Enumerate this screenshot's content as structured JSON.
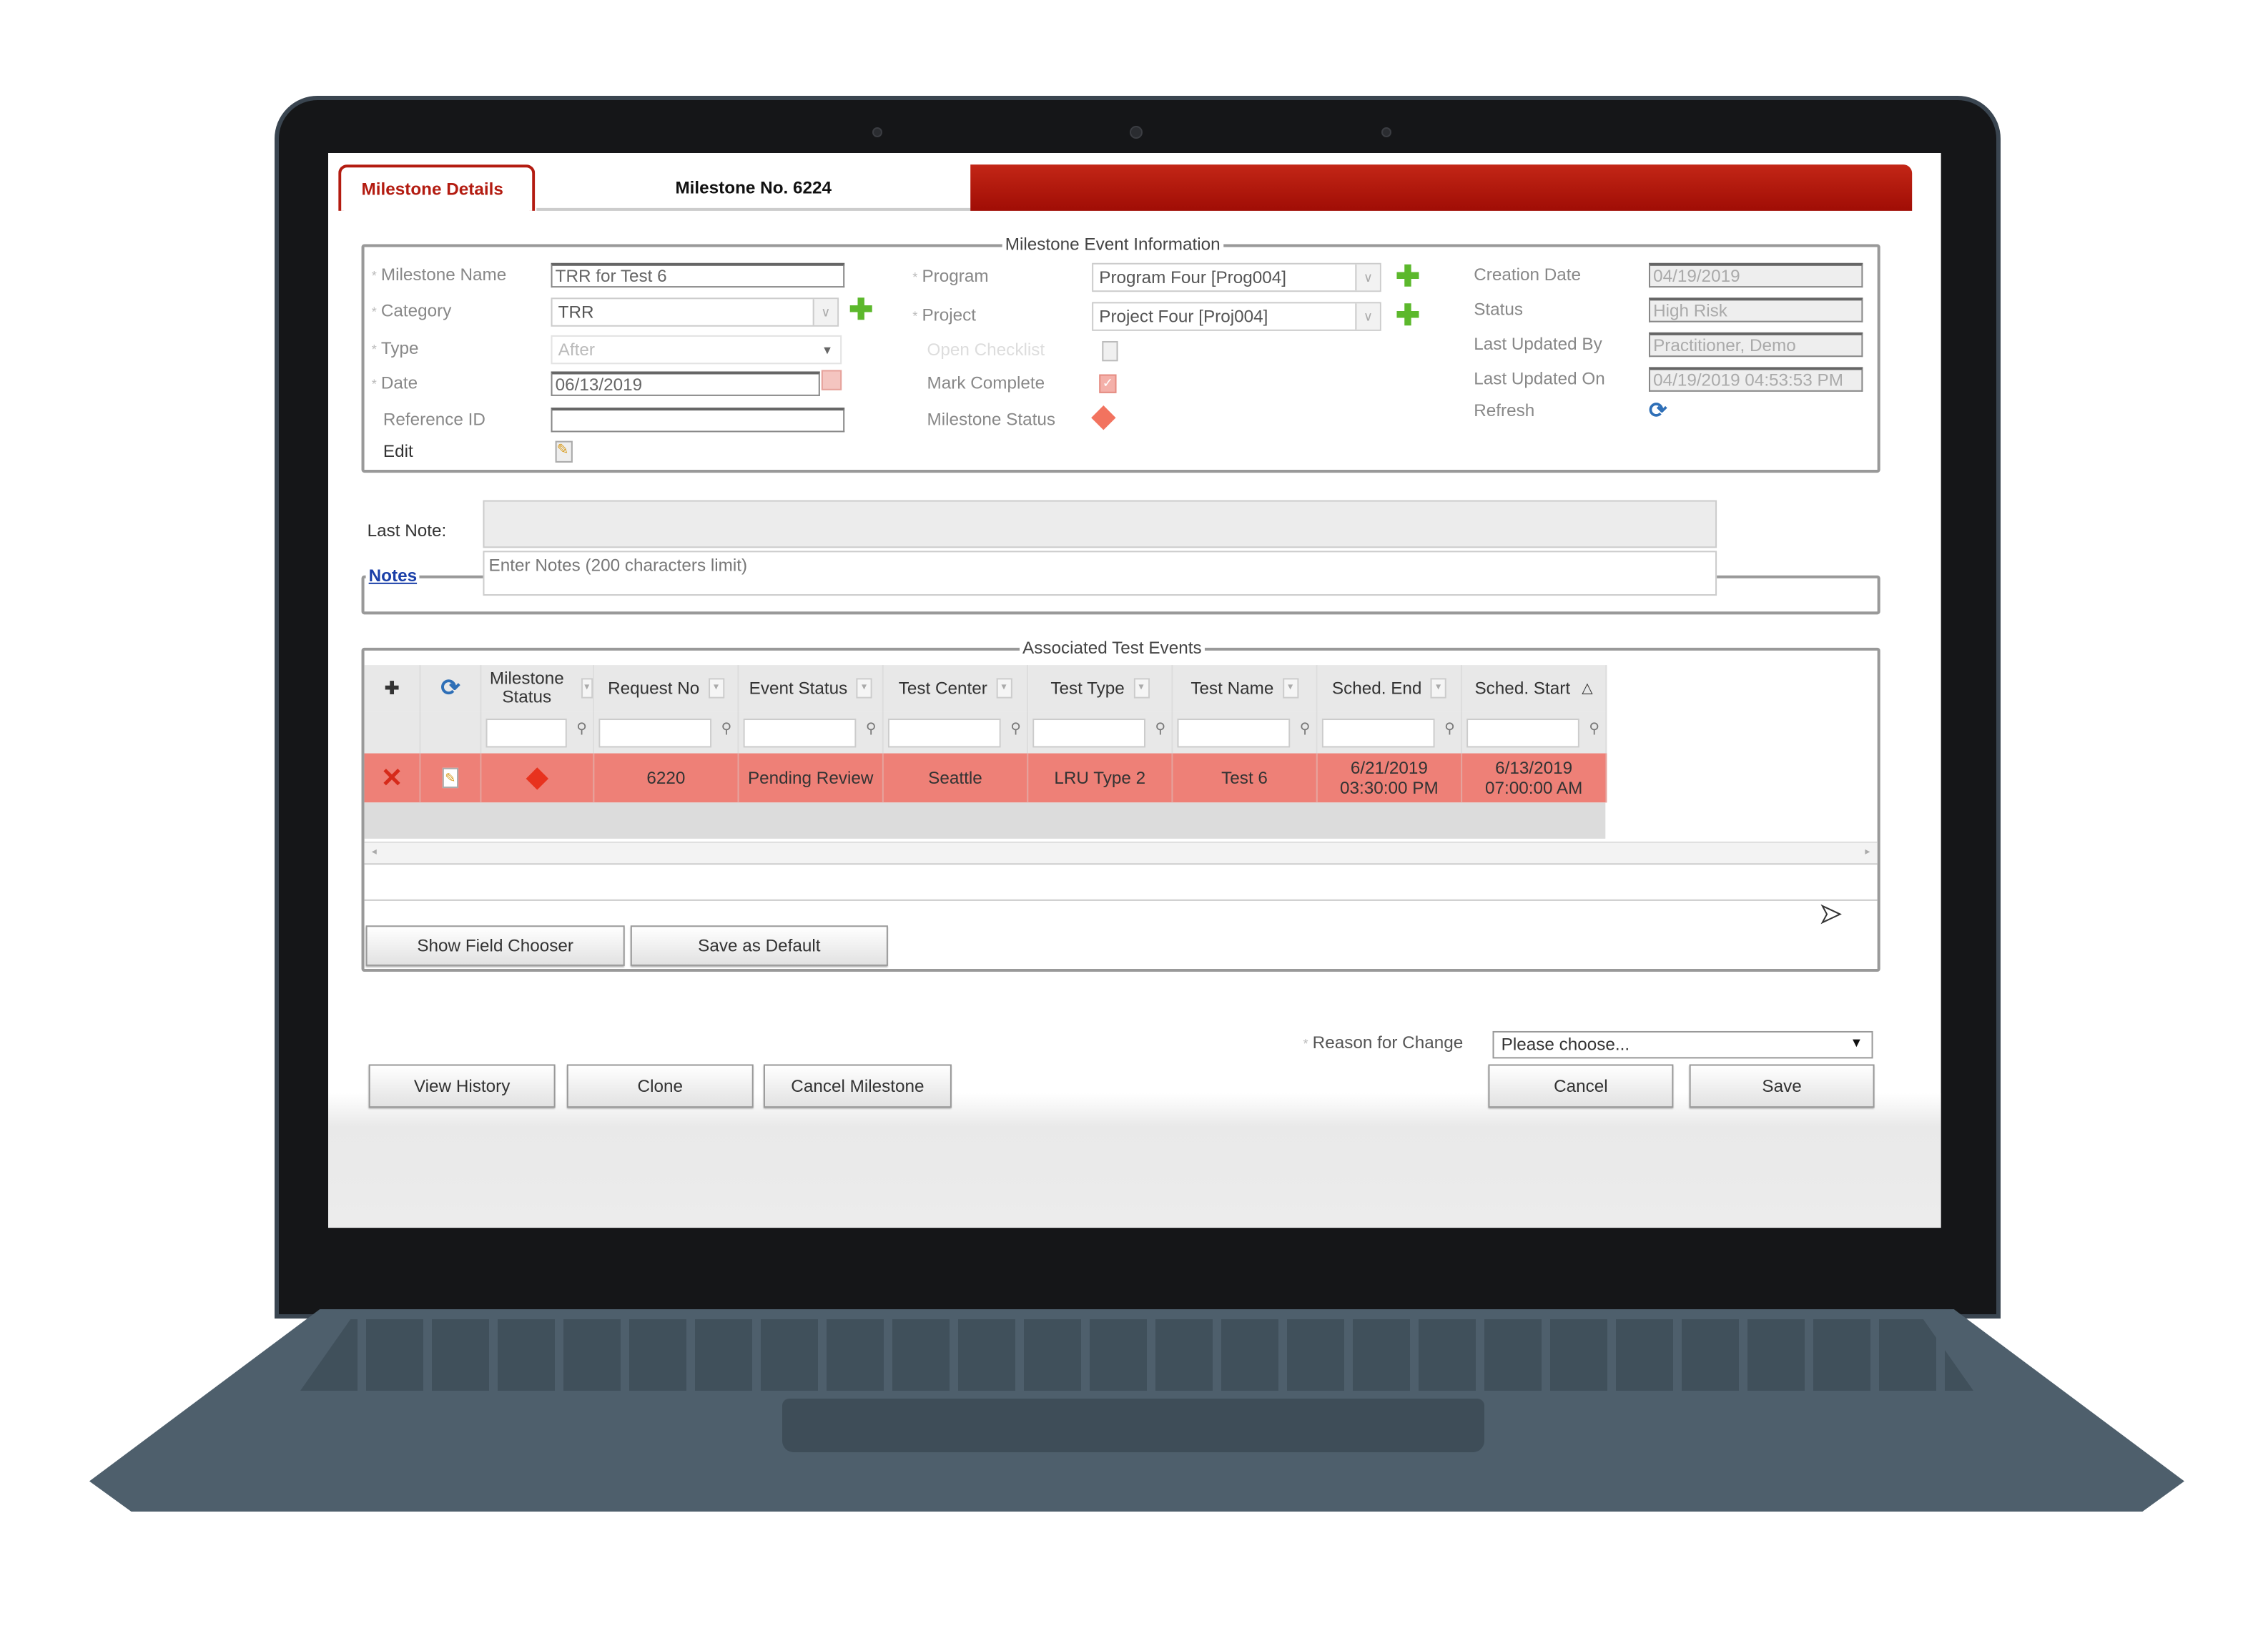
{
  "tabs": {
    "details": "Milestone Details",
    "number": "Milestone No. 6224"
  },
  "event_info": {
    "legend": "Milestone Event Information",
    "left": [
      {
        "label": "Milestone Name",
        "required": true,
        "value": "TRR for Test 6"
      },
      {
        "label": "Category",
        "required": true,
        "value": "TRR"
      },
      {
        "label": "Type",
        "required": true,
        "value": "After"
      },
      {
        "label": "Date",
        "required": true,
        "value": "06/13/2019"
      },
      {
        "label": "Reference ID",
        "required": false,
        "value": ""
      },
      {
        "label": "Edit",
        "required": false
      }
    ],
    "middle": [
      {
        "label": "Program",
        "value": "Program Four [Prog004]"
      },
      {
        "label": "Project",
        "value": "Project Four [Proj004]"
      },
      {
        "label": "Open Checklist"
      },
      {
        "label": "Mark Complete"
      },
      {
        "label": "Milestone Status"
      }
    ],
    "right": [
      {
        "label": "Creation Date",
        "value": "04/19/2019"
      },
      {
        "label": "Status",
        "value": "High Risk"
      },
      {
        "label": "Last Updated By",
        "value": "Practitioner, Demo"
      },
      {
        "label": "Last Updated On",
        "value": "04/19/2019 04:53:53 PM"
      },
      {
        "label": "Refresh"
      }
    ]
  },
  "notes": {
    "last_note_label": "Last Note:",
    "last_note": "",
    "legend": "Notes",
    "placeholder": "Enter Notes (200 characters limit)"
  },
  "grid": {
    "legend": "Associated Test Events",
    "columns": [
      "Milestone Status",
      "Request No",
      "Event Status",
      "Test Center",
      "Test Type",
      "Test Name",
      "Sched. End",
      "Sched. Start"
    ],
    "sort_indicator": "△",
    "rows": [
      {
        "status_color": "#e8321e",
        "request_no": "6220",
        "event_status": "Pending Review",
        "test_center": "Seattle",
        "test_type": "LRU Type 2",
        "test_name": "Test 6",
        "sched_end": "6/21/2019 03:30:00 PM",
        "sched_start": "6/13/2019 07:00:00 AM"
      }
    ],
    "row_color": "#ee8077",
    "show_field_chooser": "Show Field Chooser",
    "save_as_default": "Save as Default"
  },
  "reason": {
    "label": "Reason for Change",
    "value": "Please choose..."
  },
  "buttons": {
    "view_history": "View History",
    "clone": "Clone",
    "cancel_milestone": "Cancel Milestone",
    "cancel": "Cancel",
    "save": "Save"
  },
  "colors": {
    "brand_red": "#b31b10",
    "add_green": "#5cb82c"
  }
}
